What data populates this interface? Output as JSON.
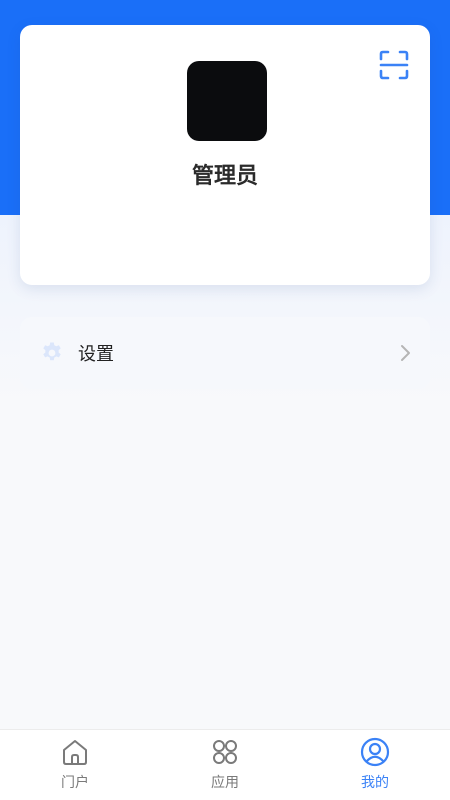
{
  "profile": {
    "username": "管理员",
    "scan_icon": "scan-icon"
  },
  "menu": {
    "settings_label": "设置",
    "settings_icon": "gear-icon"
  },
  "tabbar": {
    "tabs": [
      {
        "label": "门户",
        "icon": "home-icon",
        "active": false
      },
      {
        "label": "应用",
        "icon": "apps-icon",
        "active": false
      },
      {
        "label": "我的",
        "icon": "user-icon",
        "active": true
      }
    ]
  },
  "colors": {
    "header_blue": "#1a6ff8",
    "active_tab": "#3b82f6",
    "inactive_tab": "#7a7a7a"
  }
}
